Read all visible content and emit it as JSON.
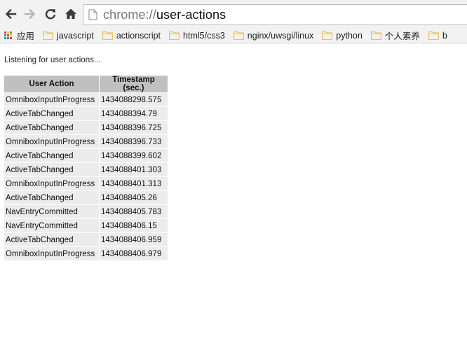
{
  "browser": {
    "nav": {
      "back_icon": "arrow-left-icon",
      "forward_icon": "arrow-right-icon",
      "reload_icon": "reload-icon",
      "home_icon": "home-icon"
    },
    "omnibox": {
      "scheme": "chrome://",
      "path": "user-actions"
    },
    "bookmarks": {
      "apps_label": "应用",
      "items": [
        {
          "label": "javascript"
        },
        {
          "label": "actionscript"
        },
        {
          "label": "html5/css3"
        },
        {
          "label": "nginx/uwsgi/linux"
        },
        {
          "label": "python"
        },
        {
          "label": "个人素养"
        },
        {
          "label": "b"
        }
      ]
    }
  },
  "page": {
    "status": "Listening for user actions...",
    "table": {
      "headers": [
        "User Action",
        "Timestamp (sec.)"
      ],
      "rows": [
        {
          "action": "OmniboxInputInProgress",
          "timestamp": "1434088298.575"
        },
        {
          "action": "ActiveTabChanged",
          "timestamp": "1434088394.79"
        },
        {
          "action": "ActiveTabChanged",
          "timestamp": "1434088396.725"
        },
        {
          "action": "OmniboxInputInProgress",
          "timestamp": "1434088396.733"
        },
        {
          "action": "ActiveTabChanged",
          "timestamp": "1434088399.602"
        },
        {
          "action": "ActiveTabChanged",
          "timestamp": "1434088401.303"
        },
        {
          "action": "OmniboxInputInProgress",
          "timestamp": "1434088401.313"
        },
        {
          "action": "ActiveTabChanged",
          "timestamp": "1434088405.26"
        },
        {
          "action": "NavEntryCommitted",
          "timestamp": "1434088405.783"
        },
        {
          "action": "NavEntryCommitted",
          "timestamp": "1434088406.15"
        },
        {
          "action": "ActiveTabChanged",
          "timestamp": "1434088406.959"
        },
        {
          "action": "OmniboxInputInProgress",
          "timestamp": "1434088406.979"
        }
      ]
    }
  },
  "colors": {
    "chrome_bg": "#f2f2f2",
    "header_bg": "#c0c0c0",
    "cell_bg": "#ececec",
    "folder": "#e8c25a",
    "apps_grid": [
      "#e53935",
      "#fbc02d",
      "#43a047",
      "#1e88e5",
      "#e53935",
      "#fbc02d",
      "#43a047",
      "#1e88e5",
      "#e53935"
    ]
  }
}
